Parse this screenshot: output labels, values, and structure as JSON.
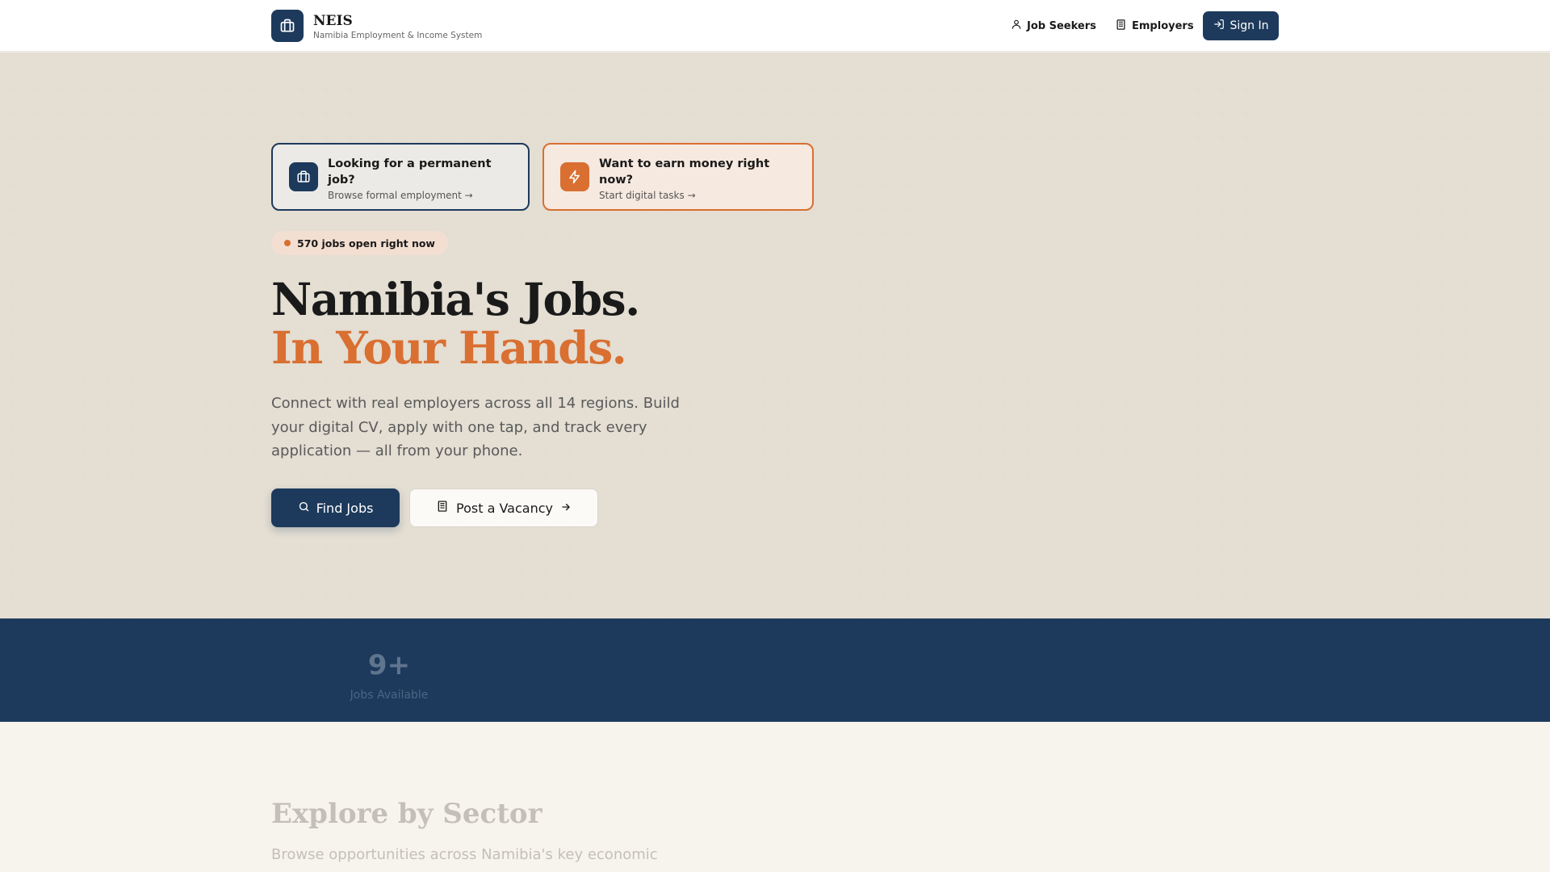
{
  "header": {
    "brand": "NEIS",
    "brand_sub": "Namibia Employment & Income System",
    "nav": {
      "job_seekers": "Job Seekers",
      "employers": "Employers",
      "sign_in": "Sign In"
    }
  },
  "hero": {
    "cards": {
      "permanent": {
        "title": "Looking for a permanent job?",
        "subtitle": "Browse formal employment →",
        "icon": "briefcase-icon"
      },
      "digital": {
        "title": "Want to earn money right now?",
        "subtitle": "Start digital tasks →",
        "icon": "lightning-icon"
      }
    },
    "badge": "570 jobs open right now",
    "title_line1": "Namibia's Jobs.",
    "title_line2": "In Your Hands.",
    "description": "Connect with real employers across all 14 regions. Build your digital CV, apply with one tap, and track every application — all from your phone.",
    "buttons": {
      "find_jobs": "Find Jobs",
      "post_vacancy": "Post a Vacancy"
    }
  },
  "stats": {
    "value": "9+",
    "label": "Jobs Available"
  },
  "sector": {
    "title": "Explore by Sector",
    "description": "Browse opportunities across Namibia's key economic sectors."
  },
  "colors": {
    "navy": "#1d3a5c",
    "accent": "#d96f31",
    "background": "#f7f4ee"
  }
}
